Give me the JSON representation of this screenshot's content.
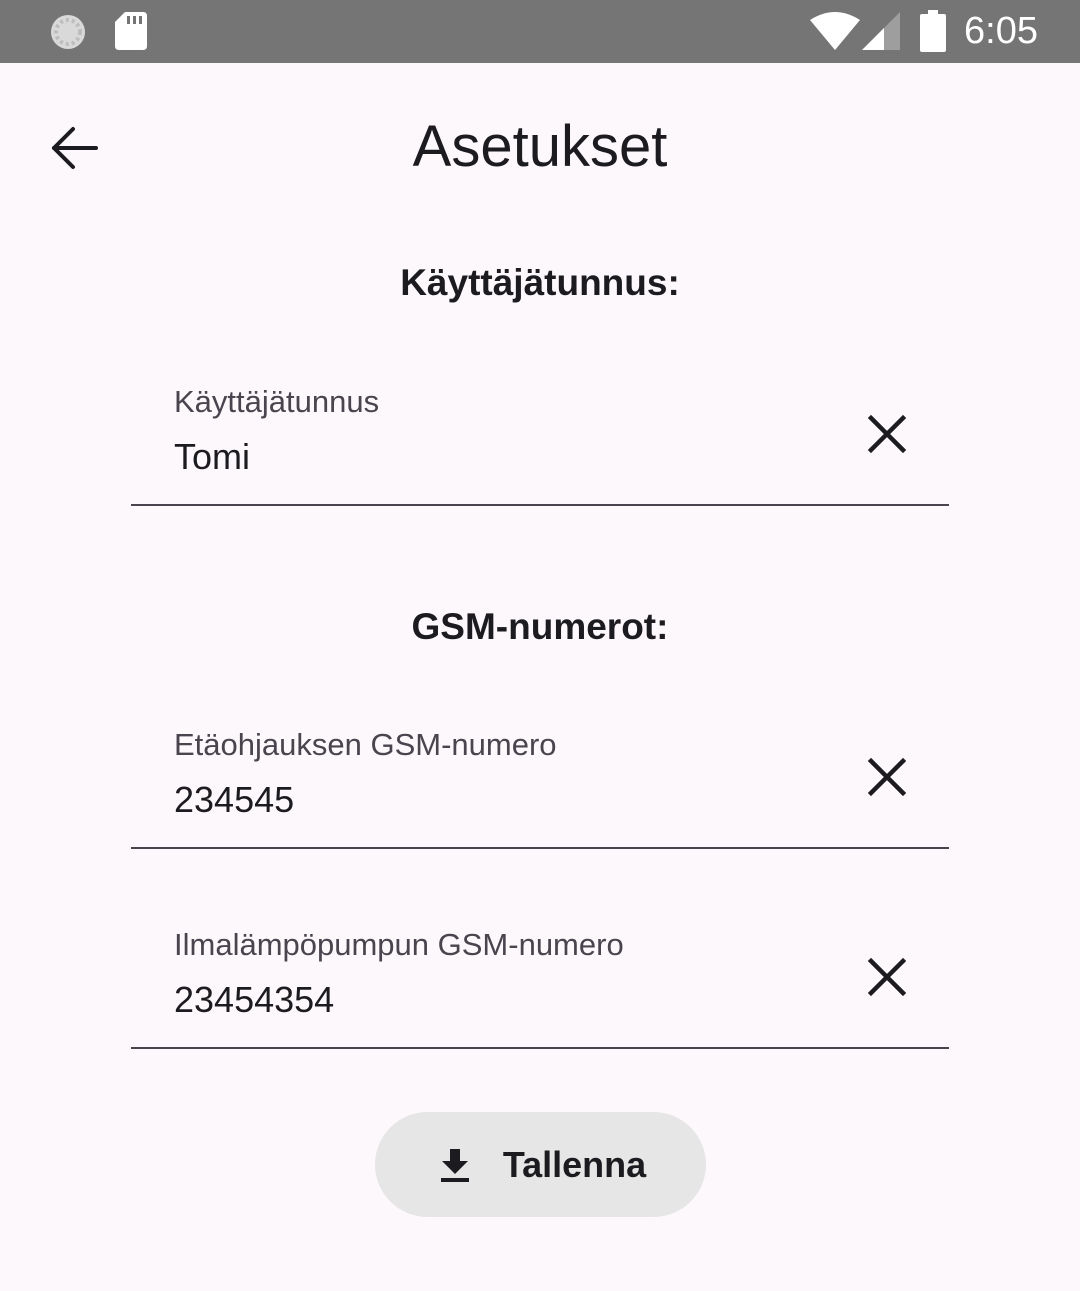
{
  "status_bar": {
    "time": "6:05",
    "icons": [
      "sync-icon",
      "sd-card-icon",
      "wifi-icon",
      "signal-icon",
      "battery-icon"
    ]
  },
  "header": {
    "title": "Asetukset",
    "back_icon": "arrow-back-icon"
  },
  "username_section": {
    "heading": "Käyttäjätunnus:",
    "field": {
      "label": "Käyttäjätunnus",
      "value": "Tomi",
      "clear_icon": "close-icon"
    }
  },
  "gsm_section": {
    "heading": "GSM-numerot:",
    "fields": [
      {
        "label": "Etäohjauksen GSM-numero",
        "value": "234545",
        "clear_icon": "close-icon"
      },
      {
        "label": "Ilmalämpöpumpun GSM-numero",
        "value": "23454354",
        "clear_icon": "close-icon"
      }
    ]
  },
  "save_button": {
    "label": "Tallenna",
    "icon": "download-icon",
    "background": "#e6e6e6"
  },
  "colors": {
    "status_bar": "#757575",
    "background": "#fdf8fc",
    "text": "#1c1b1f",
    "label": "#49454f"
  }
}
